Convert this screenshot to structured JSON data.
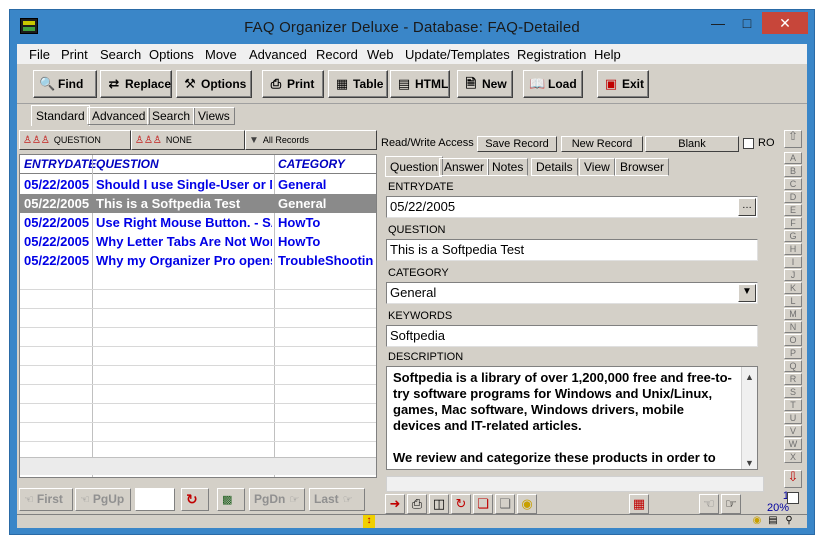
{
  "window": {
    "title": "FAQ Organizer Deluxe - Database: FAQ-Detailed"
  },
  "menu": [
    "File",
    "Print",
    "Search",
    "Options",
    "Move",
    "Advanced",
    "Record",
    "Web",
    "Update/Templates",
    "Registration",
    "Help"
  ],
  "toolbar": {
    "find": "Find",
    "replace": "Replace",
    "options": "Options",
    "print": "Print",
    "table": "Table",
    "html": "HTML",
    "new": "New",
    "load": "Load",
    "exit": "Exit"
  },
  "view_tabs": [
    "Standard",
    "Advanced",
    "Search",
    "Views"
  ],
  "sort": {
    "first": "QUESTION",
    "second": "NONE",
    "third": "All Records"
  },
  "grid": {
    "headers": [
      "ENTRYDATE",
      "QUESTION",
      "CATEGORY"
    ],
    "rows": [
      [
        "05/22/2005",
        "Should I use Single-User or Multi",
        "General"
      ],
      [
        "05/22/2005",
        "This is a Softpedia Test",
        "General"
      ],
      [
        "05/22/2005",
        "Use Right Mouse Button. - SA",
        "HowTo"
      ],
      [
        "05/22/2005",
        "Why Letter Tabs Are Not Wor",
        "HowTo"
      ],
      [
        "05/22/2005",
        "Why my Organizer Pro opens",
        "TroubleShooting"
      ]
    ],
    "selected_row": 1
  },
  "nav": {
    "first": "First",
    "pgup": "PgUp",
    "pgdn": "PgDn",
    "last": "Last"
  },
  "record_bar": {
    "access": "Read/Write Access",
    "save": "Save Record",
    "new": "New Record",
    "blank": "Blank",
    "ro": "RO"
  },
  "record_tabs": [
    "Question",
    "Answer",
    "Notes",
    "Details",
    "View",
    "Browser"
  ],
  "form": {
    "entrydate_label": "ENTRYDATE",
    "entrydate": "05/22/2005",
    "question_label": "QUESTION",
    "question": "This is a Softpedia Test",
    "category_label": "CATEGORY",
    "category": "General",
    "keywords_label": "KEYWORDS",
    "keywords": "Softpedia",
    "description_label": "DESCRIPTION",
    "description_p1": "Softpedia is a library of over 1,200,000 free and free-to-try software programs for Windows and Unix/Linux, games, Mac software, Windows drivers, mobile devices and IT-related articles.",
    "description_p2": "We review and categorize these products in order to"
  },
  "status": {
    "record_num": "1",
    "percent": "20%"
  },
  "alphabet": [
    "A",
    "B",
    "C",
    "D",
    "E",
    "F",
    "G",
    "H",
    "I",
    "J",
    "K",
    "L",
    "M",
    "N",
    "O",
    "P",
    "Q",
    "R",
    "S",
    "T",
    "U",
    "V",
    "W",
    "X"
  ],
  "colors": {
    "title_bar": "#3a86c8",
    "link_text": "#0000e6",
    "selected_row": "#8a8a8a",
    "close_button": "#c7463a"
  }
}
